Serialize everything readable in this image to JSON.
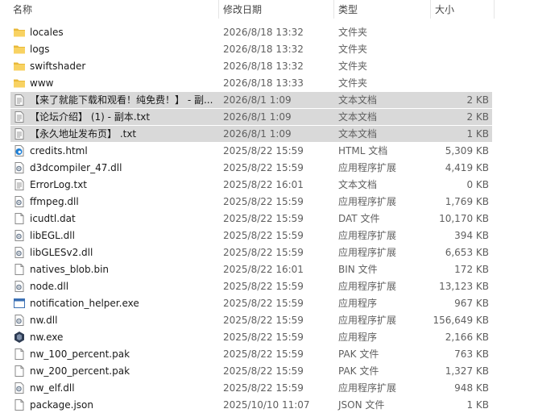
{
  "header": {
    "name": "名称",
    "date": "修改日期",
    "type": "类型",
    "size": "大小"
  },
  "files": [
    {
      "name": "locales",
      "date": "2026/8/18 13:32",
      "type": "文件夹",
      "size": "",
      "icon": "folder-icon",
      "selected": false
    },
    {
      "name": "logs",
      "date": "2026/8/18 13:32",
      "type": "文件夹",
      "size": "",
      "icon": "folder-icon",
      "selected": false
    },
    {
      "name": "swiftshader",
      "date": "2026/8/18 13:32",
      "type": "文件夹",
      "size": "",
      "icon": "folder-icon",
      "selected": false
    },
    {
      "name": "www",
      "date": "2026/8/18 13:33",
      "type": "文件夹",
      "size": "",
      "icon": "folder-icon",
      "selected": false
    },
    {
      "name": "【来了就能下载和观看！纯免费！】 - 副...",
      "date": "2026/8/1 1:09",
      "type": "文本文档",
      "size": "2 KB",
      "icon": "text-file-icon",
      "selected": true
    },
    {
      "name": "【论坛介绍】 (1) - 副本.txt",
      "date": "2026/8/1 1:09",
      "type": "文本文档",
      "size": "2 KB",
      "icon": "text-file-icon",
      "selected": true
    },
    {
      "name": "【永久地址发布页】 .txt",
      "date": "2026/8/1 1:09",
      "type": "文本文档",
      "size": "1 KB",
      "icon": "text-file-icon",
      "selected": true
    },
    {
      "name": "credits.html",
      "date": "2025/8/22 15:59",
      "type": "HTML 文档",
      "size": "5,309 KB",
      "icon": "edge-html-icon",
      "selected": false
    },
    {
      "name": "d3dcompiler_47.dll",
      "date": "2025/8/22 15:59",
      "type": "应用程序扩展",
      "size": "4,419 KB",
      "icon": "dll-gear-icon",
      "selected": false
    },
    {
      "name": "ErrorLog.txt",
      "date": "2025/8/22 16:01",
      "type": "文本文档",
      "size": "0 KB",
      "icon": "text-file-icon",
      "selected": false
    },
    {
      "name": "ffmpeg.dll",
      "date": "2025/8/22 15:59",
      "type": "应用程序扩展",
      "size": "1,769 KB",
      "icon": "dll-gear-icon",
      "selected": false
    },
    {
      "name": "icudtl.dat",
      "date": "2025/8/22 15:59",
      "type": "DAT 文件",
      "size": "10,170 KB",
      "icon": "blank-file-icon",
      "selected": false
    },
    {
      "name": "libEGL.dll",
      "date": "2025/8/22 15:59",
      "type": "应用程序扩展",
      "size": "394 KB",
      "icon": "dll-gear-icon",
      "selected": false
    },
    {
      "name": "libGLESv2.dll",
      "date": "2025/8/22 15:59",
      "type": "应用程序扩展",
      "size": "6,653 KB",
      "icon": "dll-gear-icon",
      "selected": false
    },
    {
      "name": "natives_blob.bin",
      "date": "2025/8/22 16:01",
      "type": "BIN 文件",
      "size": "172 KB",
      "icon": "blank-file-icon",
      "selected": false
    },
    {
      "name": "node.dll",
      "date": "2025/8/22 15:59",
      "type": "应用程序扩展",
      "size": "13,123 KB",
      "icon": "dll-gear-icon",
      "selected": false
    },
    {
      "name": "notification_helper.exe",
      "date": "2025/8/22 15:59",
      "type": "应用程序",
      "size": "967 KB",
      "icon": "exe-window-icon",
      "selected": false
    },
    {
      "name": "nw.dll",
      "date": "2025/8/22 15:59",
      "type": "应用程序扩展",
      "size": "156,649 KB",
      "icon": "dll-gear-icon",
      "selected": false
    },
    {
      "name": "nw.exe",
      "date": "2025/8/22 15:59",
      "type": "应用程序",
      "size": "2,166 KB",
      "icon": "nwjs-app-icon",
      "selected": false
    },
    {
      "name": "nw_100_percent.pak",
      "date": "2025/8/22 15:59",
      "type": "PAK 文件",
      "size": "763 KB",
      "icon": "blank-file-icon",
      "selected": false
    },
    {
      "name": "nw_200_percent.pak",
      "date": "2025/8/22 15:59",
      "type": "PAK 文件",
      "size": "1,327 KB",
      "icon": "blank-file-icon",
      "selected": false
    },
    {
      "name": "nw_elf.dll",
      "date": "2025/8/22 15:59",
      "type": "应用程序扩展",
      "size": "948 KB",
      "icon": "dll-gear-icon",
      "selected": false
    },
    {
      "name": "package.json",
      "date": "2025/10/10 11:07",
      "type": "JSON 文件",
      "size": "1 KB",
      "icon": "blank-file-icon",
      "selected": false
    }
  ]
}
